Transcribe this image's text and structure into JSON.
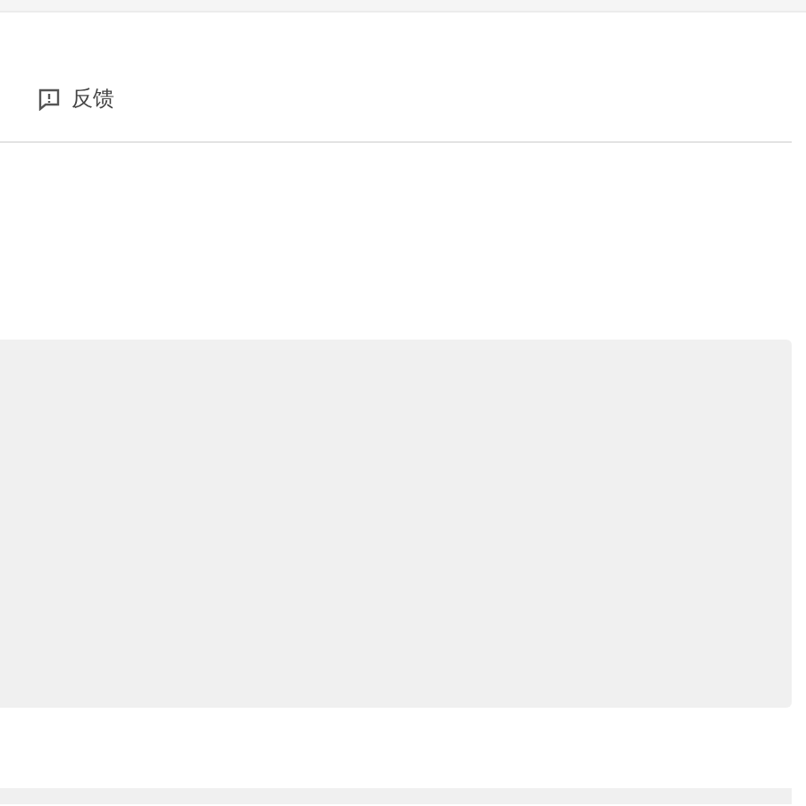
{
  "feedback": {
    "label": "反馈"
  }
}
